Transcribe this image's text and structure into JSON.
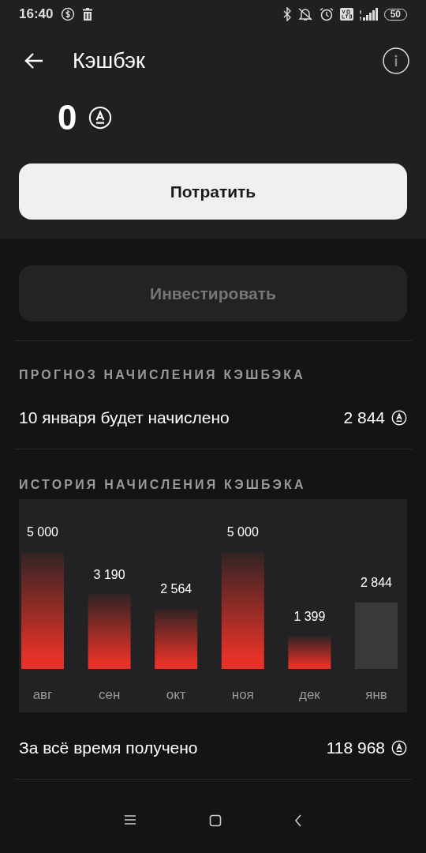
{
  "status_bar": {
    "time": "16:40",
    "battery": "50"
  },
  "header": {
    "title": "Кэшбэк"
  },
  "balance": {
    "amount": "0"
  },
  "buttons": [
    {
      "label": "Потратить",
      "kind": "primary",
      "disabled": false
    },
    {
      "label": "Инвестировать",
      "kind": "secondary",
      "disabled": true
    }
  ],
  "forecast": {
    "heading": "ПРОГНОЗ НАЧИСЛЕНИЯ КЭШБЭКА",
    "label": "10 января будет начислено",
    "value": "2 844"
  },
  "history": {
    "heading": "ИСТОРИЯ НАЧИСЛЕНИЯ КЭШБЭКА",
    "chart_data": {
      "type": "bar",
      "categories": [
        "авг",
        "сен",
        "окт",
        "ноя",
        "дек",
        "янв"
      ],
      "ylim": [
        0,
        5000
      ],
      "stacked": true,
      "data_labels": true,
      "series": [
        {
          "color": "#e53228",
          "values": [
            5000,
            3190,
            2564,
            5000,
            1399,
            null
          ]
        },
        {
          "color": "#3a3a3c",
          "values": [
            null,
            null,
            null,
            null,
            null,
            2844
          ]
        }
      ]
    }
  },
  "total": {
    "label": "За всё время получено",
    "value": "118 968"
  }
}
